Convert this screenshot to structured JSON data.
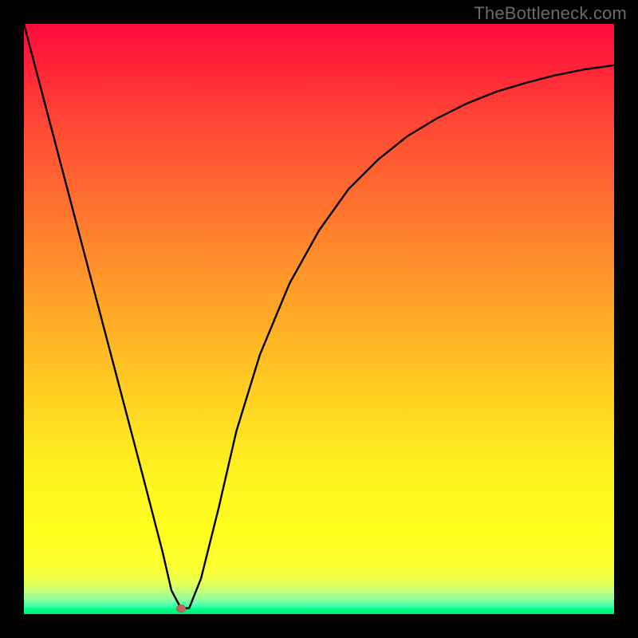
{
  "watermark": "TheBottleneck.com",
  "colors": {
    "black": "#000000",
    "gradient_top": "#ff0a3a",
    "gradient_mid1": "#ff8e2a",
    "gradient_mid2": "#fff31f",
    "gradient_bottom": "#00ed6e",
    "curve": "#000000",
    "marker": "#c1655a"
  },
  "marker": {
    "x_frac": 0.266,
    "y_frac": 0.99
  },
  "chart_data": {
    "type": "line",
    "title": "",
    "xlabel": "",
    "ylabel": "",
    "xlim": [
      0,
      100
    ],
    "ylim": [
      0,
      100
    ],
    "grid": false,
    "legend": false,
    "annotations": [
      "TheBottleneck.com"
    ],
    "series": [
      {
        "name": "curve",
        "x": [
          0,
          5,
          10,
          15,
          20,
          23.5,
          25,
          26.6,
          28,
          30,
          33,
          36,
          40,
          45,
          50,
          55,
          60,
          65,
          70,
          75,
          80,
          85,
          90,
          95,
          100
        ],
        "values": [
          100,
          81,
          62,
          43,
          24,
          10.5,
          4,
          1,
          1,
          6,
          18,
          31,
          44,
          56,
          65,
          72,
          77,
          81,
          84,
          86.5,
          88.5,
          90,
          91.3,
          92.3,
          93
        ]
      }
    ],
    "marker_point": {
      "x": 26.6,
      "y": 1
    }
  }
}
